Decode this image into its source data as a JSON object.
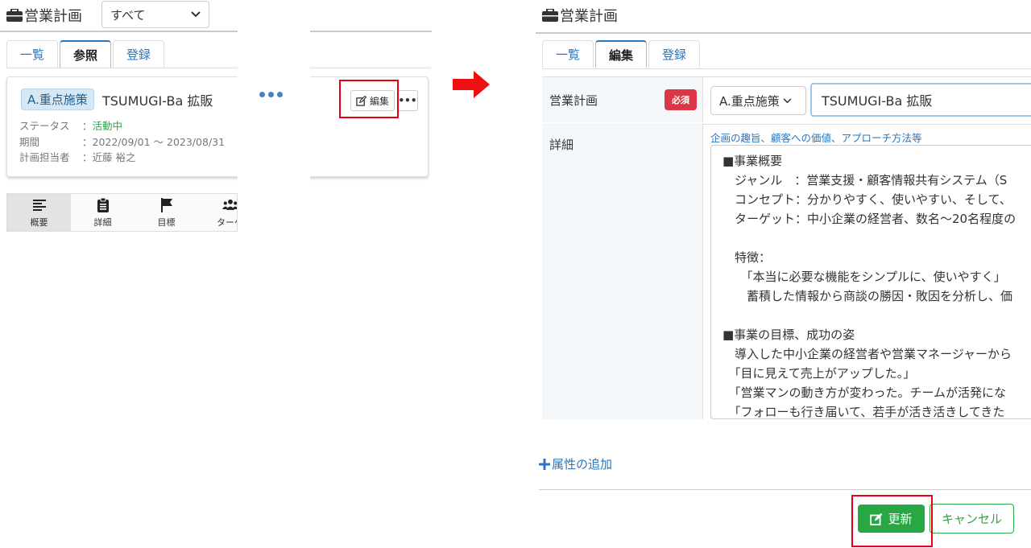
{
  "left": {
    "app_title": "営業計画",
    "filter_value": "すべて",
    "tabs": [
      {
        "label": "一覧"
      },
      {
        "label": "参照"
      },
      {
        "label": "登録"
      }
    ],
    "card": {
      "tag": "A.重点施策",
      "title": "TSUMUGI-Ba 拡販",
      "status_key": "ステータス",
      "status_value": "：活動中",
      "period_key": "期間",
      "period_value": "：2022/09/01 ～ 2023/08/31",
      "owner_key": "計画担当者",
      "owner_value": "：近藤 裕之",
      "edit_label": "編集",
      "more_label": "•••"
    },
    "bottom_tabs": [
      {
        "label": "概要",
        "icon": "lines-icon"
      },
      {
        "label": "詳細",
        "icon": "clipboard-icon"
      },
      {
        "label": "目標",
        "icon": "flag-icon"
      },
      {
        "label": "ターゲ",
        "icon": "users-icon"
      }
    ]
  },
  "right": {
    "app_title": "営業計画",
    "tabs": [
      {
        "label": "一覧"
      },
      {
        "label": "編集"
      },
      {
        "label": "登録"
      }
    ],
    "field_plan_label": "営業計画",
    "required_badge": "必須",
    "category_value": "A.重点施策",
    "name_value": "TSUMUGI-Ba 拡販",
    "field_detail_label": "詳細",
    "detail_hint": "企画の趣旨、顧客への価値、アプローチ方法等",
    "detail_lines": [
      "■事業概要",
      "　ジャンル　：営業支援・顧客情報共有システム（S",
      "　コンセプト：分かりやすく、使いやすい、そして、",
      "　ターゲット：中小企業の経営者、数名～20名程度の",
      "",
      "　特徴：",
      "　　「本当に必要な機能をシンプルに、使いやすく」",
      "　　蓄積した情報から商談の勝因・敗因を分析し、価",
      "",
      "■事業の目標、成功の姿",
      "　導入した中小企業の経営者や営業マネージャーから",
      "　「目に見えて売上がアップした。」",
      "　「営業マンの動き方が変わった。チームが活発にな",
      "　「フォローも行き届いて、若手が活き活きしてきた"
    ],
    "add_attribute": "属性の追加",
    "update_label": "更新",
    "cancel_label": "キャンセル"
  },
  "colors": {
    "link_blue": "#2a76bd",
    "success_green": "#28a745",
    "danger_red": "#dc3545",
    "highlight_red": "#e60012"
  }
}
